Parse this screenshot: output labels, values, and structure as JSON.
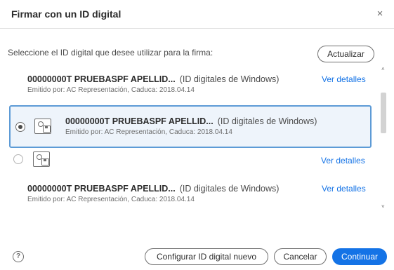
{
  "dialog": {
    "title": "Firmar con un ID digital",
    "close_glyph": "×",
    "prompt": "Seleccione el ID digital que desee utilizar para la firma:",
    "refresh_label": "Actualizar"
  },
  "certificates": [
    {
      "name": "00000000T PRUEBASPF APELLID...",
      "type": "(ID digitales de Windows)",
      "issued": "Emitido por: AC Representación, Caduca: 2018.04.14",
      "details_label": "Ver detalles"
    },
    {
      "name": "00000000T PRUEBASPF APELLID...",
      "type": "(ID digitales de Windows)",
      "issued": "Emitido por: AC Representación, Caduca: 2018.04.14",
      "selected": true
    },
    {
      "details_label": "Ver detalles"
    },
    {
      "name": "00000000T PRUEBASPF APELLID...",
      "type": "(ID digitales de Windows)",
      "issued": "Emitido por: AC Representación, Caduca: 2018.04.14",
      "details_label": "Ver detalles"
    }
  ],
  "footer": {
    "help_glyph": "?",
    "configure_label": "Configurar ID digital nuevo",
    "cancel_label": "Cancelar",
    "continue_label": "Continuar"
  },
  "scroll": {
    "up_glyph": "˄",
    "down_glyph": "˅"
  },
  "colors": {
    "accent": "#1473e6",
    "selected_border": "#5d9bd6",
    "selected_bg": "#eef4fb"
  },
  "icons": [
    "close-icon",
    "certificate-icon",
    "help-icon",
    "scroll-up-icon",
    "scroll-down-icon"
  ]
}
